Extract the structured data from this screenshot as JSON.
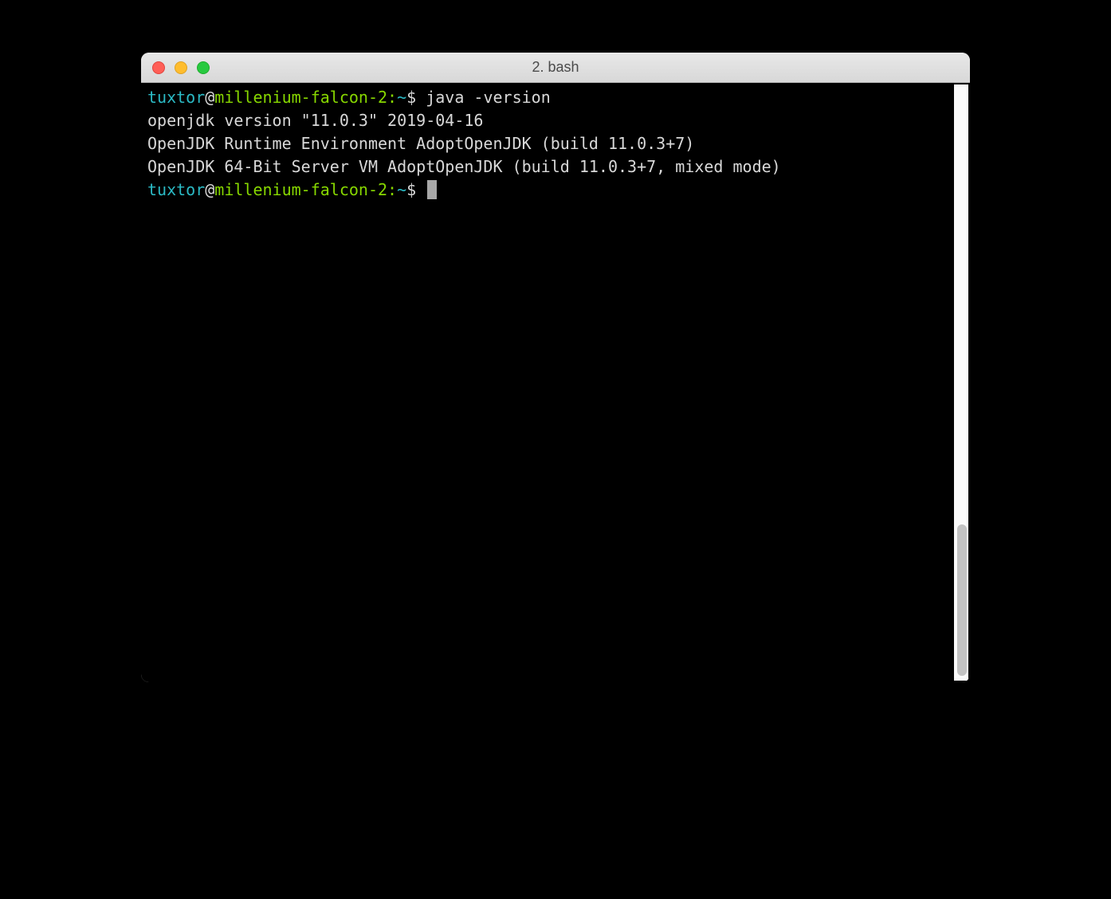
{
  "window": {
    "title": "2. bash"
  },
  "terminal": {
    "prompt1": {
      "user": "tuxtor",
      "at": "@",
      "host": "millenium-falcon-2:",
      "tilde": "~",
      "dollar": "$ ",
      "command": "java -version"
    },
    "output": {
      "line1": "openjdk version \"11.0.3\" 2019-04-16",
      "line2": "OpenJDK Runtime Environment AdoptOpenJDK (build 11.0.3+7)",
      "line3": "OpenJDK 64-Bit Server VM AdoptOpenJDK (build 11.0.3+7, mixed mode)"
    },
    "prompt2": {
      "user": "tuxtor",
      "at": "@",
      "host": "millenium-falcon-2:",
      "tilde": "~",
      "dollar": "$ "
    }
  }
}
